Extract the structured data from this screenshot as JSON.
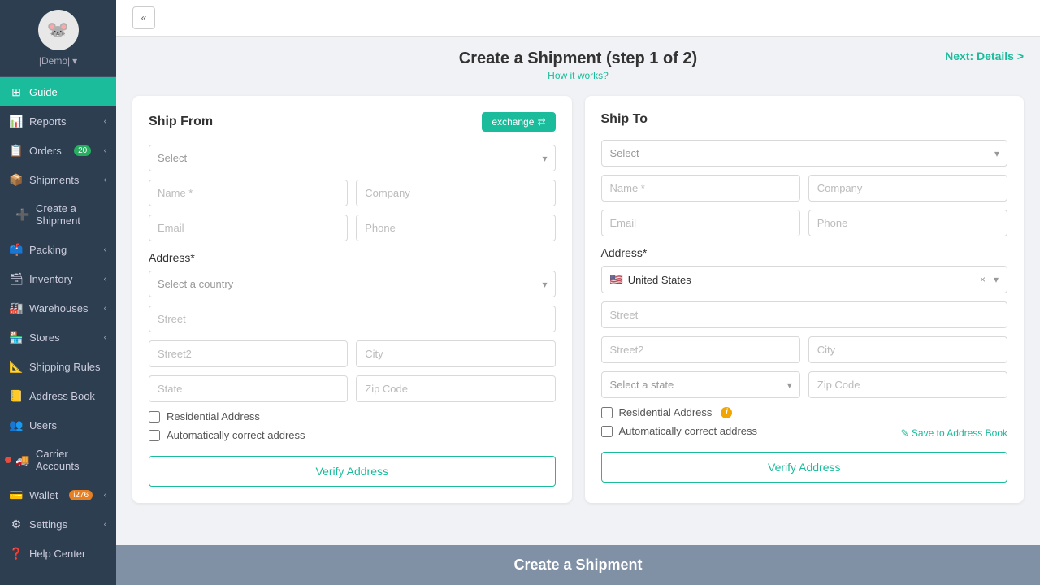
{
  "app": {
    "demo_label": "|Demo|",
    "back_icon": "«"
  },
  "sidebar": {
    "items": [
      {
        "id": "guide",
        "label": "Guide",
        "icon": "⊞",
        "active": true,
        "badge": null
      },
      {
        "id": "reports",
        "label": "Reports",
        "icon": "📊",
        "active": false,
        "badge": null,
        "chevron": true
      },
      {
        "id": "orders",
        "label": "Orders",
        "icon": "📋",
        "active": false,
        "badge": "20",
        "chevron": true
      },
      {
        "id": "shipments",
        "label": "Shipments",
        "icon": "📦",
        "active": false,
        "badge": null,
        "chevron": true
      },
      {
        "id": "create-shipment",
        "label": "Create a Shipment",
        "icon": "➕",
        "active": false
      },
      {
        "id": "packing",
        "label": "Packing",
        "icon": "📫",
        "active": false,
        "chevron": true
      },
      {
        "id": "inventory",
        "label": "Inventory",
        "icon": "🗃",
        "active": false,
        "chevron": true
      },
      {
        "id": "warehouses",
        "label": "Warehouses",
        "icon": "🏭",
        "active": false,
        "chevron": true
      },
      {
        "id": "stores",
        "label": "Stores",
        "icon": "🏪",
        "active": false,
        "chevron": true
      },
      {
        "id": "shipping-rules",
        "label": "Shipping Rules",
        "icon": "📐",
        "active": false
      },
      {
        "id": "address-book",
        "label": "Address Book",
        "icon": "📒",
        "active": false
      },
      {
        "id": "users",
        "label": "Users",
        "icon": "👥",
        "active": false
      },
      {
        "id": "carrier-accounts",
        "label": "Carrier Accounts",
        "icon": "🚚",
        "active": false,
        "dot": true
      },
      {
        "id": "wallet",
        "label": "Wallet",
        "icon": "💳",
        "active": false,
        "badge": "i276",
        "chevron": true
      },
      {
        "id": "settings",
        "label": "Settings",
        "icon": "⚙",
        "active": false,
        "chevron": true
      },
      {
        "id": "help-center",
        "label": "Help Center",
        "icon": "❓",
        "active": false
      }
    ]
  },
  "page": {
    "title": "Create a Shipment (step 1 of 2)",
    "subtitle": "How it works?",
    "next_label": "Next: Details >"
  },
  "ship_from": {
    "panel_title": "Ship From",
    "exchange_label": "exchange",
    "select_placeholder": "Select",
    "name_placeholder": "Name *",
    "company_placeholder": "Company",
    "email_placeholder": "Email",
    "phone_placeholder": "Phone",
    "address_label": "Address*",
    "country_placeholder": "Select a country",
    "street_placeholder": "Street",
    "street2_placeholder": "Street2",
    "city_placeholder": "City",
    "state_placeholder": "State",
    "zip_placeholder": "Zip Code",
    "residential_label": "Residential Address",
    "auto_correct_label": "Automatically correct address",
    "verify_btn": "Verify Address"
  },
  "ship_to": {
    "panel_title": "Ship To",
    "select_placeholder": "Select",
    "name_placeholder": "Name *",
    "company_placeholder": "Company",
    "email_placeholder": "Email",
    "phone_placeholder": "Phone",
    "address_label": "Address*",
    "country_value": "United States",
    "country_flag": "🇺🇸",
    "street_placeholder": "Street",
    "street2_placeholder": "Street2",
    "city_placeholder": "City",
    "state_placeholder": "Select a state",
    "zip_placeholder": "Zip Code",
    "residential_label": "Residential Address",
    "auto_correct_label": "Automatically correct address",
    "save_link": "Save to Address Book",
    "verify_btn": "Verify Address"
  },
  "bottom_bar": {
    "title": "Create a Shipment"
  }
}
